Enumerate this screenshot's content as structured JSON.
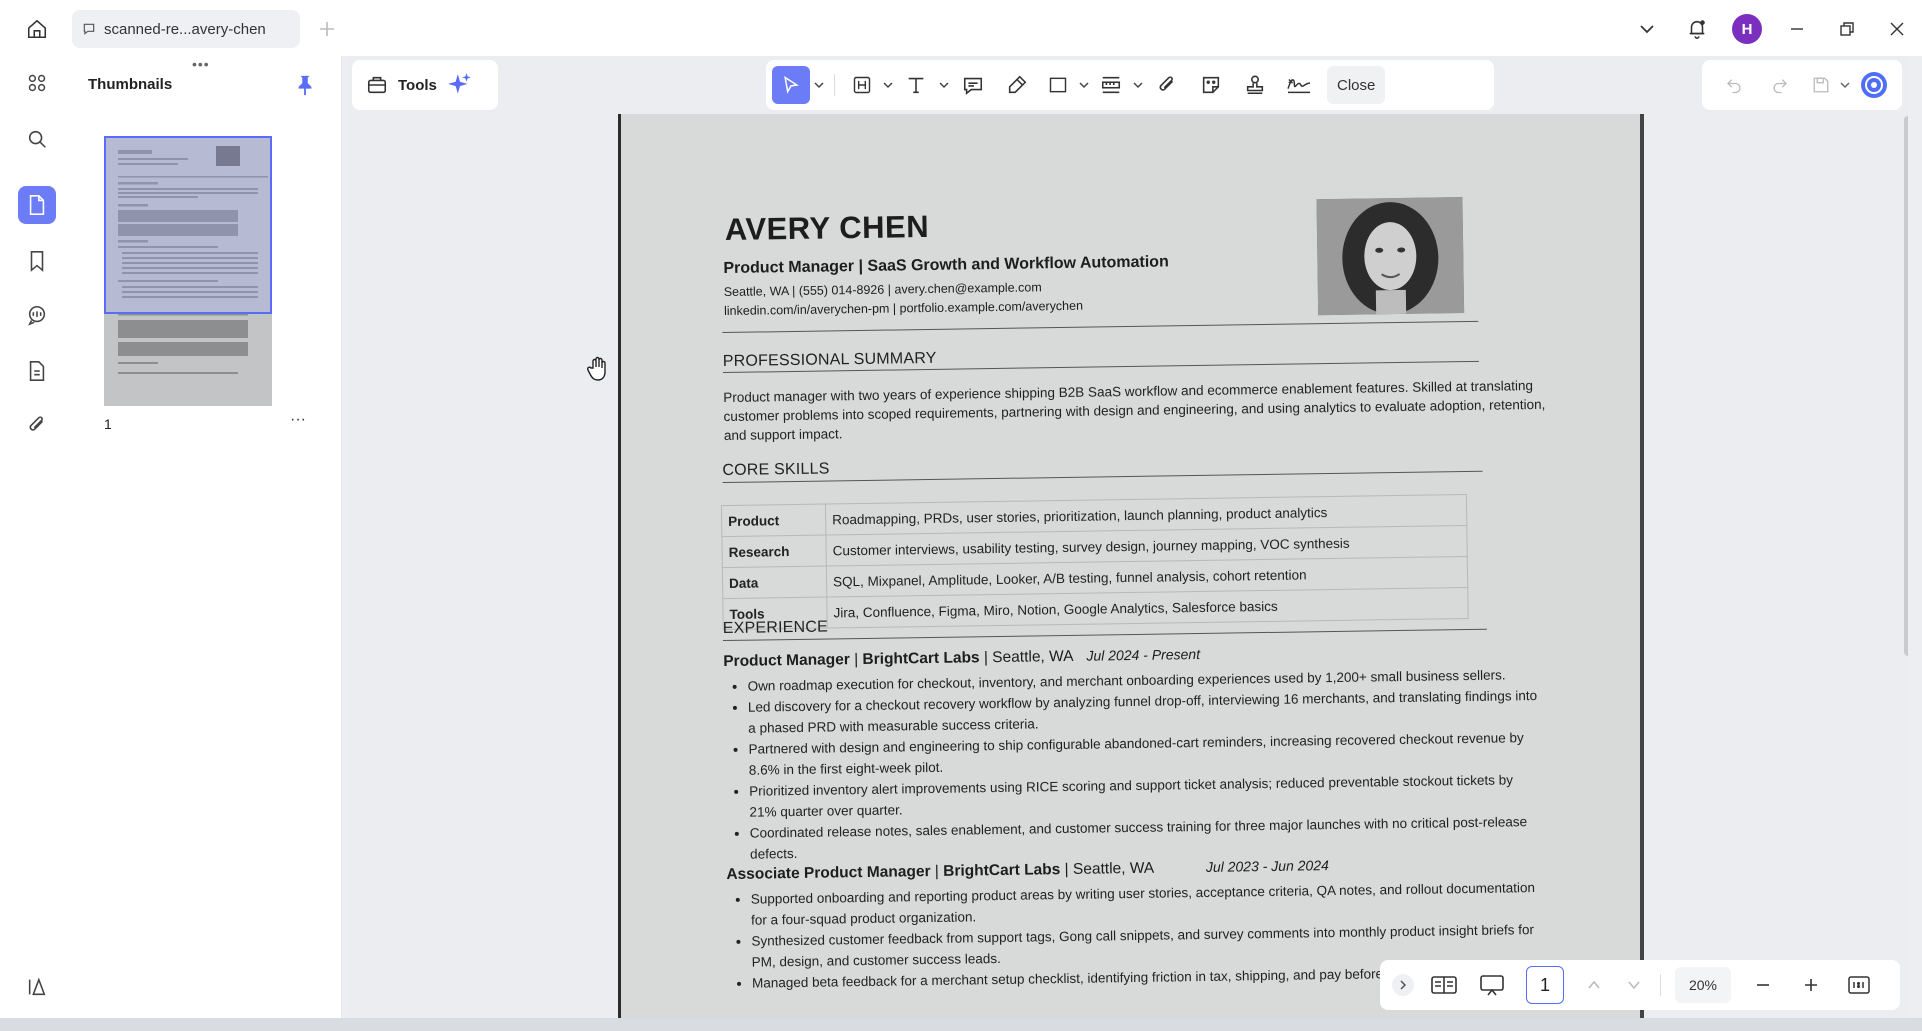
{
  "window": {
    "tab_title": "scanned-re...avery-chen",
    "avatar_initial": "H"
  },
  "panel": {
    "title": "Thumbnails",
    "grip": "•••",
    "thumb_page_number": "1",
    "more": "···"
  },
  "toolbar": {
    "tools_label": "Tools",
    "close_label": "Close"
  },
  "navigation": {
    "current_page": "1",
    "zoom": "20%"
  },
  "colors": {
    "accent": "#6b7cf6",
    "avatar": "#7b2fbe"
  },
  "document": {
    "name": "AVERY CHEN",
    "role": "Product Manager | SaaS Growth and Workflow Automation",
    "contact_line1": "Seattle, WA | (555) 014-8926 | avery.chen@example.com",
    "contact_line2": "linkedin.com/in/averychen-pm | portfolio.example.com/averychen",
    "summary_heading": "PROFESSIONAL SUMMARY",
    "summary": "Product manager with two years of experience shipping B2B SaaS workflow and ecommerce enablement features. Skilled at translating customer problems into scoped requirements, partnering with design and engineering, and using analytics to evaluate adoption, retention, and support impact.",
    "skills_heading": "CORE SKILLS",
    "skills": [
      {
        "label": "Product",
        "value": "Roadmapping, PRDs, user stories, prioritization, launch planning, product analytics"
      },
      {
        "label": "Research",
        "value": "Customer interviews, usability testing, survey design, journey mapping, VOC synthesis"
      },
      {
        "label": "Data",
        "value": "SQL, Mixpanel, Amplitude, Looker, A/B testing, funnel analysis, cohort retention"
      },
      {
        "label": "Tools",
        "value": "Jira, Confluence, Figma, Miro, Notion, Google Analytics, Salesforce basics"
      }
    ],
    "experience_heading": "EXPERIENCE",
    "job1": {
      "title": "Product Manager",
      "company": "BrightCart Labs",
      "location": "Seattle, WA",
      "dates": "Jul 2024 - Present",
      "bullets": [
        "Own roadmap execution for checkout, inventory, and merchant onboarding experiences used by 1,200+ small business sellers.",
        "Led discovery for a checkout recovery workflow by analyzing funnel drop-off, interviewing 16 merchants, and translating findings into a phased PRD with measurable success criteria.",
        "Partnered with design and engineering to ship configurable abandoned-cart reminders, increasing recovered checkout revenue by 8.6% in the first eight-week pilot.",
        "Prioritized inventory alert improvements using RICE scoring and support ticket analysis; reduced preventable stockout tickets by 21% quarter over quarter.",
        "Coordinated release notes, sales enablement, and customer success training for three major launches with no critical post-release defects."
      ]
    },
    "job2": {
      "title": "Associate Product Manager",
      "company": "BrightCart Labs",
      "location": "Seattle, WA",
      "dates": "Jul 2023 - Jun 2024",
      "bullets": [
        "Supported onboarding and reporting product areas by writing user stories, acceptance criteria, QA notes, and rollout documentation for a four-squad product organization.",
        "Synthesized customer feedback from support tags, Gong call snippets, and survey comments into monthly product insight briefs for PM, design, and customer success leads.",
        "Managed beta feedback for a merchant setup checklist, identifying friction in tax, shipping, and pay before general availability."
      ]
    }
  }
}
